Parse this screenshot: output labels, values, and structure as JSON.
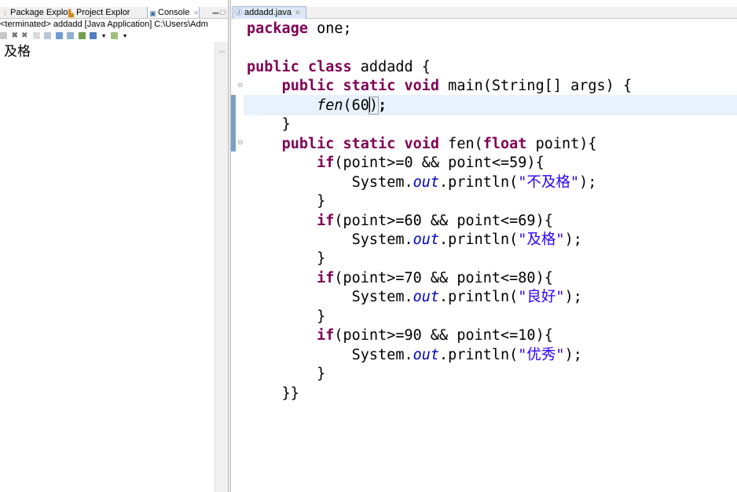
{
  "console_panel": {
    "tabs": [
      {
        "label": "Package Explo",
        "icon": "package-explorer-icon"
      },
      {
        "label": "Project Explor",
        "icon": "project-explorer-icon"
      },
      {
        "label": "Console",
        "icon": "console-icon",
        "active": true,
        "close": "✕"
      }
    ],
    "status": "<terminated> addadd [Java Application] C:\\Users\\Adm",
    "output": "及格"
  },
  "editor": {
    "tab": {
      "label": "addadd.java",
      "close": "✕"
    },
    "code": {
      "l1_kw": "package",
      "l1_rest": " one;",
      "l3_kw": "public class",
      "l3_rest": " addadd {",
      "l4_kw": "public static void",
      "l4_rest": " main(String[] args) {",
      "l5_call": "fen",
      "l5_a": "(60",
      "l5_b": ")",
      "l5_c": ";",
      "l6": "}",
      "l7_kw": "public static void",
      "l7_mid": " fen(",
      "l7_kw2": "float",
      "l7_rest": " point){",
      "ifs": [
        {
          "kw": "if",
          "cond": "(point>=0 && point<=59){",
          "sys": "System.",
          "out": "out",
          "println": ".println(",
          "str": "\"不及格\"",
          "end": ");",
          "close": "}"
        },
        {
          "kw": "if",
          "cond": "(point>=60 && point<=69){",
          "sys": "System.",
          "out": "out",
          "println": ".println(",
          "str": "\"及格\"",
          "end": ");",
          "close": "}"
        },
        {
          "kw": "if",
          "cond": "(point>=70 && point<=80){",
          "sys": "System.",
          "out": "out",
          "println": ".println(",
          "str": "\"良好\"",
          "end": ");",
          "close": "}"
        },
        {
          "kw": "if",
          "cond": "(point>=90 && point<=10){",
          "sys": "System.",
          "out": "out",
          "println": ".println(",
          "str": "\"优秀\"",
          "end": ");",
          "close": "}"
        }
      ],
      "last": "}}"
    }
  },
  "colors": {
    "keyword": "#7f0055",
    "field": "#0000c0",
    "string": "#2a00ff",
    "current_line": "#e8f2fe"
  }
}
